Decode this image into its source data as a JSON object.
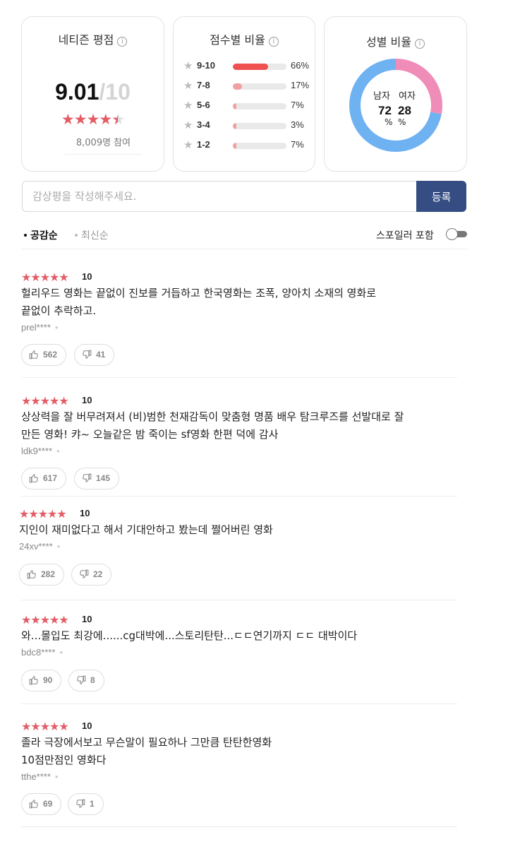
{
  "netizen": {
    "title": "네티즌 평점",
    "score": "9.01",
    "sep": "/",
    "max": "10",
    "participants": "8,009명 참여"
  },
  "distribution": {
    "title": "점수별 비율",
    "rows": [
      {
        "label": "9-10",
        "percent": 66,
        "percent_text": "66%"
      },
      {
        "label": "7-8",
        "percent": 17,
        "percent_text": "17%"
      },
      {
        "label": "5-6",
        "percent": 7,
        "percent_text": "7%"
      },
      {
        "label": "3-4",
        "percent": 3,
        "percent_text": "3%"
      },
      {
        "label": "1-2",
        "percent": 7,
        "percent_text": "7%"
      }
    ],
    "bar_color_top": "#ef5050",
    "bar_color": "#f0a0a0"
  },
  "gender": {
    "title": "성별 비율",
    "male_label": "남자",
    "female_label": "여자",
    "male": 72,
    "female": 28,
    "male_value": "72",
    "female_value": "28",
    "unit": "%",
    "male_color": "#6fb2f2",
    "female_color": "#f08cb8"
  },
  "write": {
    "placeholder": "감상평을 작성해주세요.",
    "submit_label": "등록"
  },
  "sort": {
    "sympathy": "공감순",
    "latest": "최신순",
    "spoiler_label": "스포일러 포함"
  },
  "reviews": [
    {
      "stars": "★★★★★",
      "score": "10",
      "text": "헐리우드 영화는 끝없이 진보를 거듭하고 한국영화는 조폭, 양아치 소재의 영화로\n끝없이 추락하고.",
      "user": "prel****",
      "likes": "562",
      "dislikes": "41"
    },
    {
      "stars": "★★★★★",
      "score": "10",
      "text": "상상력을 잘 버무려져서 (비)범한 천재감독이 맞춤형 명품 배우 탐크루즈를 선발대로 잘\n만든 영화! 캬~ 오늘같은 밤 죽이는 sf영화 한편 덕에 감사",
      "user": "ldk9****",
      "likes": "617",
      "dislikes": "145"
    },
    {
      "stars": "★★★★★",
      "score": "10",
      "text": "지인이 재미없다고 해서 기대안하고 봤는데 쩔어버린 영화",
      "user": "24xv****",
      "likes": "282",
      "dislikes": "22"
    },
    {
      "stars": "★★★★★",
      "score": "10",
      "text": "와...몰입도 최강에......cg대박에...스토리탄탄...ㄷㄷ연기까지 ㄷㄷ 대박이다",
      "user": "bdc8****",
      "likes": "90",
      "dislikes": "8"
    },
    {
      "stars": "★★★★★",
      "score": "10",
      "text": "졸라 극장에서보고 무슨말이 필요하나 그만큼 탄탄한영화\n10점만점인 영화다",
      "user": "tthe****",
      "likes": "69",
      "dislikes": "1"
    }
  ]
}
